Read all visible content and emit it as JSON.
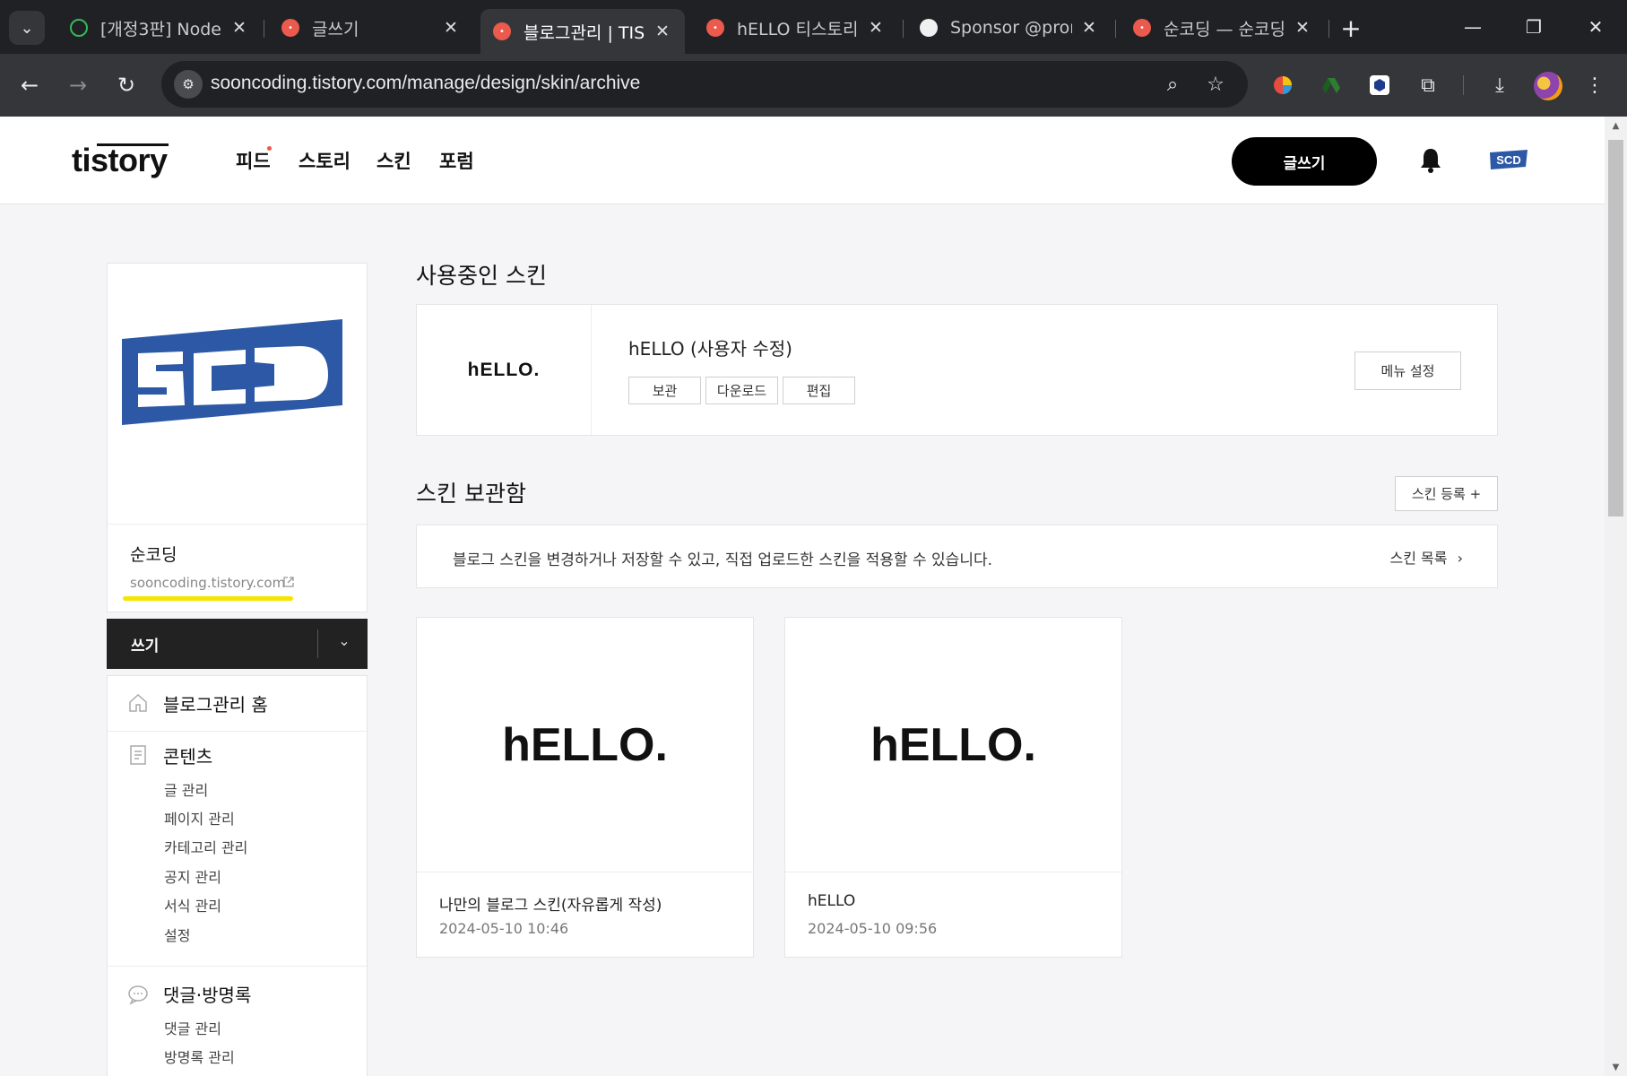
{
  "browser": {
    "tabs": [
      {
        "label": "[개정3판] Node.",
        "favicon": "node-icon",
        "active": false
      },
      {
        "label": "글쓰기",
        "favicon": "tistory-icon",
        "active": false
      },
      {
        "label": "블로그관리 | TIS",
        "favicon": "tistory-icon",
        "active": true
      },
      {
        "label": "hELLO 티스토리",
        "favicon": "tistory-icon",
        "active": false
      },
      {
        "label": "Sponsor @pron",
        "favicon": "github-icon",
        "active": false
      },
      {
        "label": "순코딩 — 순코딩",
        "favicon": "tistory-icon",
        "active": false
      }
    ],
    "url": "sooncoding.tistory.com/manage/design/skin/archive"
  },
  "header": {
    "logo": "tistory",
    "nav": [
      "피드",
      "스토리",
      "스킨",
      "포럼"
    ],
    "write_button": "글쓰기"
  },
  "sidebar": {
    "blog_name": "순코딩",
    "blog_url": "sooncoding.tistory.com",
    "write_dropdown": "쓰기",
    "home": "블로그관리 홈",
    "groups": [
      {
        "title": "콘텐츠",
        "items": [
          "글 관리",
          "페이지 관리",
          "카테고리 관리",
          "공지 관리",
          "서식 관리",
          "설정"
        ]
      },
      {
        "title": "댓글·방명록",
        "items": [
          "댓글 관리",
          "방명록 관리"
        ]
      }
    ]
  },
  "main": {
    "current_title": "사용중인 스킨",
    "current_skin": {
      "thumb_text": "hELLO.",
      "name": "hELLO (사용자 수정)",
      "buttons": [
        "보관",
        "다운로드",
        "편집"
      ],
      "menu_settings": "메뉴 설정"
    },
    "archive_title": "스킨 보관함",
    "register_button": "스킨 등록 +",
    "info_text": "블로그 스킨을 변경하거나 저장할 수 있고, 직접 업로드한 스킨을 적용할 수 있습니다.",
    "skin_list_link": "스킨 목록",
    "cards": [
      {
        "thumb_text": "hELLO.",
        "name": "나만의 블로그 스킨(자유롭게 작성)",
        "date": "2024-05-10 10:46"
      },
      {
        "thumb_text": "hELLO.",
        "name": "hELLO",
        "date": "2024-05-10 09:56"
      }
    ]
  }
}
